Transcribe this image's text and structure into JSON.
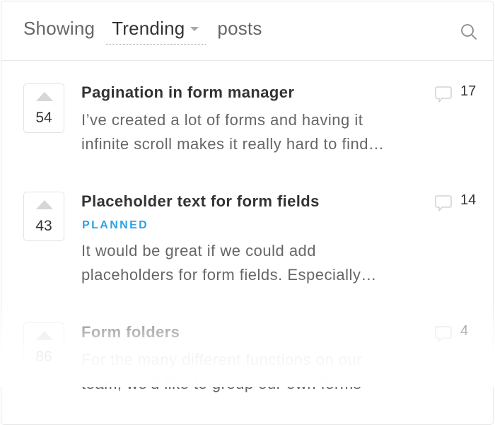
{
  "header": {
    "prefix": "Showing",
    "sort_value": "Trending",
    "suffix": "posts",
    "search_icon": "search-icon"
  },
  "colors": {
    "status_planned": "#2aa2e8"
  },
  "posts": [
    {
      "votes": "54",
      "title": "Pagination in form manager",
      "status": "",
      "body_lines": [
        "I’ve created a lot of forms and having it",
        "infinite scroll makes it really hard to find…"
      ],
      "comments": "17"
    },
    {
      "votes": "43",
      "title": "Placeholder text for form fields",
      "status": "PLANNED",
      "body_lines": [
        "It would be great if we could add",
        "placeholders for form fields. Especially…"
      ],
      "comments": "14"
    },
    {
      "votes": "86",
      "title": "Form folders",
      "status": "",
      "body_lines": [
        "For the many different functions on our",
        "team, we'd like to group our own forms"
      ],
      "comments": "4"
    }
  ]
}
